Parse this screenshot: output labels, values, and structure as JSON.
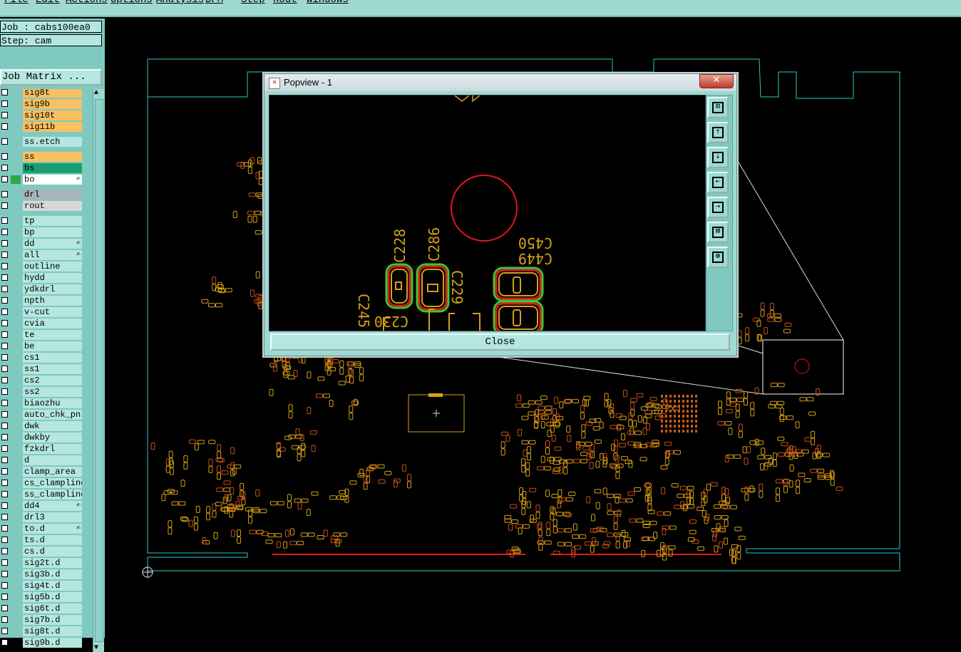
{
  "menubar": {
    "items": [
      "File",
      "Edit",
      "Actions",
      "Options",
      "Analysis",
      "DFM",
      "Step",
      "Rout",
      "Windows"
    ]
  },
  "job": {
    "job_label": "Job : cabs100ea0",
    "step_label": "Step: cam",
    "matrix_button": "Job Matrix ..."
  },
  "layers": [
    {
      "name": "sig8t",
      "color": "#f8c060"
    },
    {
      "name": "sig9b",
      "color": "#f8c060"
    },
    {
      "name": "sig10t",
      "color": "#f8c060"
    },
    {
      "name": "sig11b",
      "color": "#f8c060"
    },
    {
      "name": "ss.etch",
      "color": "#b5e6e0",
      "gap": true
    },
    {
      "name": "ss",
      "color": "#f8c060",
      "gap": true
    },
    {
      "name": "bs",
      "color": "#1a9e6e"
    },
    {
      "name": "bo",
      "color": "#ffffff",
      "swatch": "#2fa84a",
      "mark": "✍"
    },
    {
      "name": "drl",
      "color": "#a8b4b8",
      "gap": true
    },
    {
      "name": "rout",
      "color": "#d8d8d8"
    },
    {
      "name": "tp",
      "color": "#b5e6e0",
      "gap": true
    },
    {
      "name": "bp",
      "color": "#b5e6e0"
    },
    {
      "name": "dd",
      "color": "#b5e6e0",
      "mark": "✍"
    },
    {
      "name": "all",
      "color": "#b5e6e0",
      "mark": "✍"
    },
    {
      "name": "outline",
      "color": "#b5e6e0"
    },
    {
      "name": "hydd",
      "color": "#b5e6e0"
    },
    {
      "name": "ydkdrl",
      "color": "#b5e6e0"
    },
    {
      "name": "npth",
      "color": "#b5e6e0"
    },
    {
      "name": "v-cut",
      "color": "#b5e6e0"
    },
    {
      "name": "cvia",
      "color": "#b5e6e0"
    },
    {
      "name": "te",
      "color": "#b5e6e0"
    },
    {
      "name": "be",
      "color": "#b5e6e0"
    },
    {
      "name": "cs1",
      "color": "#b5e6e0"
    },
    {
      "name": "ss1",
      "color": "#b5e6e0"
    },
    {
      "name": "cs2",
      "color": "#b5e6e0"
    },
    {
      "name": "ss2",
      "color": "#b5e6e0"
    },
    {
      "name": "biaozhu",
      "color": "#b5e6e0"
    },
    {
      "name": "auto_chk_pnl",
      "color": "#b5e6e0"
    },
    {
      "name": "dwk",
      "color": "#b5e6e0"
    },
    {
      "name": "dwkby",
      "color": "#b5e6e0"
    },
    {
      "name": "fzkdrl",
      "color": "#b5e6e0"
    },
    {
      "name": "d",
      "color": "#b5e6e0"
    },
    {
      "name": "clamp_area",
      "color": "#b5e6e0"
    },
    {
      "name": "cs_clampline",
      "color": "#b5e6e0"
    },
    {
      "name": "ss_clampline",
      "color": "#b5e6e0"
    },
    {
      "name": "dd4",
      "color": "#b5e6e0",
      "mark": "✍"
    },
    {
      "name": "drl3",
      "color": "#b5e6e0"
    },
    {
      "name": "to.d",
      "color": "#b5e6e0",
      "mark": "✍"
    },
    {
      "name": "ts.d",
      "color": "#b5e6e0"
    },
    {
      "name": "cs.d",
      "color": "#b5e6e0"
    },
    {
      "name": "sig2t.d",
      "color": "#b5e6e0"
    },
    {
      "name": "sig3b.d",
      "color": "#b5e6e0"
    },
    {
      "name": "sig4t.d",
      "color": "#b5e6e0"
    },
    {
      "name": "sig5b.d",
      "color": "#b5e6e0"
    },
    {
      "name": "sig6t.d",
      "color": "#b5e6e0"
    },
    {
      "name": "sig7b.d",
      "color": "#b5e6e0"
    },
    {
      "name": "sig8t.d",
      "color": "#b5e6e0"
    },
    {
      "name": "sig9b.d",
      "color": "#b5e6e0"
    }
  ],
  "popup": {
    "title": "Popview - 1",
    "close_x": "✕",
    "close_button": "Close",
    "labels": [
      "C228",
      "C286",
      "C450",
      "C449",
      "C229",
      "C230",
      "C245"
    ],
    "tools": [
      "zoom-home-icon",
      "pan-up-icon",
      "pan-down-icon",
      "pan-left-icon",
      "pan-right-icon",
      "zoom-out-icon",
      "zoom-in-icon"
    ]
  },
  "colors": {
    "outline": "#2fc8c8",
    "component": "#d4a017",
    "pad_red": "#e01818",
    "pad_green": "#38c838",
    "panel": "#9ed9d2"
  }
}
